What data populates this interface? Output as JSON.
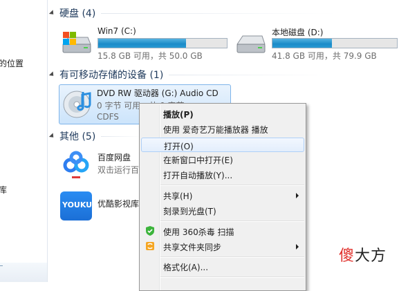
{
  "nav": {
    "items": [
      {
        "label": "的位置"
      },
      {
        "label": "库"
      }
    ]
  },
  "groups": {
    "hard_disk": {
      "title": "硬盘 (4)"
    },
    "removable": {
      "title": "有可移动存储的设备 (1)"
    },
    "other": {
      "title": "其他 (5)"
    }
  },
  "drives": [
    {
      "name": "Win7 (C:)",
      "info": "15.8 GB 可用，共 50.0 GB",
      "used_fraction": 0.684
    },
    {
      "name": "本地磁盘 (D:)",
      "info": "41.8 GB 可用，共 79.9 GB",
      "used_fraction": 0.477
    }
  ],
  "dvd": {
    "name": "DVD RW 驱动器 (G:) Audio CD",
    "space": "0 字节 可用，共 0 字节",
    "fs": "CDFS"
  },
  "apps": [
    {
      "name": "百度网盘",
      "desc": "双击运行百度网盘"
    },
    {
      "name": "优酷影视库",
      "icon_text": "YOUKU"
    }
  ],
  "context_menu": {
    "items": [
      {
        "label": "播放(P)"
      },
      {
        "label": "使用 爱奇艺万能播放器 播放"
      },
      {
        "label": "打开(O)"
      },
      {
        "label": "在新窗口中打开(E)"
      },
      {
        "label": "打开自动播放(Y)..."
      },
      {
        "label": "共享(H)"
      },
      {
        "label": "刻录到光盘(T)"
      },
      {
        "label": "使用 360杀毒 扫描"
      },
      {
        "label": "共享文件夹同步"
      },
      {
        "label": "格式化(A)..."
      }
    ]
  },
  "watermark": {
    "part1": "傻",
    "part2": "大方"
  },
  "colors": {
    "accent_bar": "#1a8bc8",
    "selection": "#cce4fb",
    "group_title": "#1e395b",
    "watermark_red": "#e0302b"
  },
  "icons": {
    "drive": "hard-drive-icon",
    "dvd": "dvd-drive-icon",
    "baidu": "baidu-netdisk-icon",
    "youku": "youku-icon",
    "shield": "360-shield-icon",
    "sync": "sync-folder-icon"
  }
}
